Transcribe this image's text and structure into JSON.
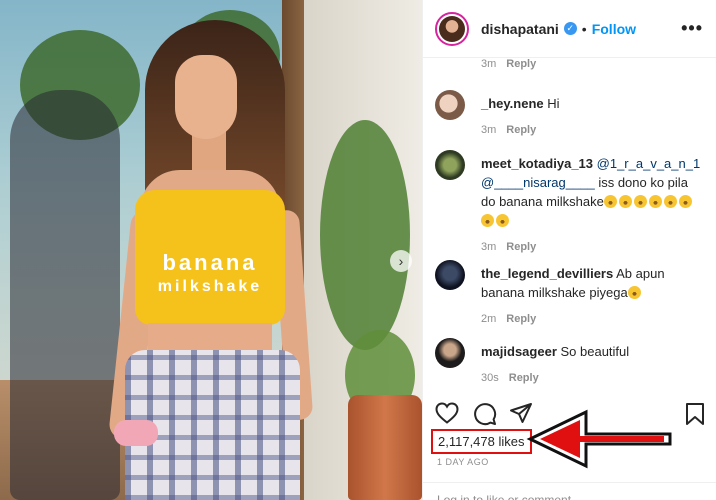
{
  "post": {
    "username": "dishapatani",
    "follow_label": "Follow",
    "separator": "•",
    "more_label": "•••",
    "photo_text_line1": "banana",
    "photo_text_line2": "milkshake",
    "carousel_next": "›"
  },
  "comments": [
    {
      "username": "",
      "text": "",
      "time": "3m",
      "reply": "Reply"
    },
    {
      "username": "_hey.nene",
      "text": "Hi",
      "time": "3m",
      "reply": "Reply"
    },
    {
      "username": "meet_kotadiya_13",
      "mention1": "@1_r_a_v_a_n_1",
      "mention2": "@____nisarag____",
      "text": "iss dono ko pila do banana milkshake",
      "time": "3m",
      "reply": "Reply"
    },
    {
      "username": "the_legend_devilliers",
      "text": "Ab apun banana milkshake piyega",
      "time": "2m",
      "reply": "Reply"
    },
    {
      "username": "majidsageer",
      "text": "So beautiful",
      "time": "30s",
      "reply": "Reply"
    }
  ],
  "footer": {
    "likes": "2,117,478 likes",
    "posted": "1 DAY AGO",
    "add_comment_placeholder": "Log in to like or comment."
  },
  "colors": {
    "accent": "#0095f6",
    "highlight": "#e01010",
    "verified": "#3897f0"
  },
  "icons": [
    "heart-icon",
    "comment-icon",
    "share-icon",
    "bookmark-icon",
    "verified-icon",
    "more-options-icon",
    "arrow-icon"
  ]
}
